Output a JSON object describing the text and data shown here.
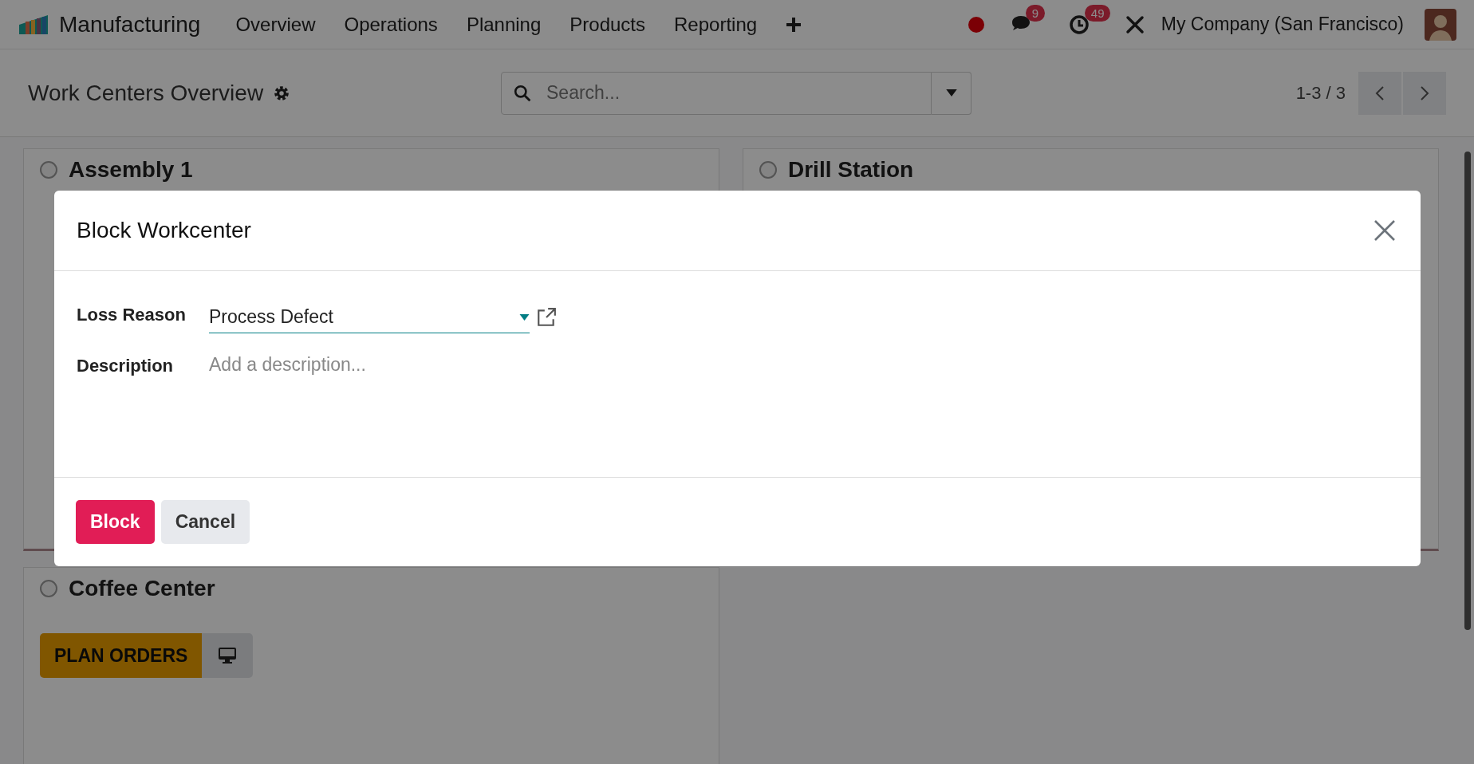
{
  "navbar": {
    "app_name": "Manufacturing",
    "menu": [
      "Overview",
      "Operations",
      "Planning",
      "Products",
      "Reporting"
    ],
    "messages_count": "9",
    "activities_count": "49",
    "company": "My Company (San Francisco)"
  },
  "control_panel": {
    "title": "Work Centers Overview",
    "search": {
      "placeholder": "Search..."
    },
    "pager": "1-3 / 3"
  },
  "work_centers": [
    {
      "name": "Assembly 1"
    },
    {
      "name": "Drill Station"
    },
    {
      "name": "Coffee Center",
      "plan_button": "PLAN ORDERS"
    }
  ],
  "dialog": {
    "title": "Block Workcenter",
    "fields": [
      {
        "label": "Loss Reason",
        "kind": "many2one",
        "value": "Process Defect"
      },
      {
        "label": "Description",
        "kind": "text",
        "placeholder": "Add a description..."
      }
    ],
    "buttons": [
      {
        "label": "Block",
        "kind": "primary"
      },
      {
        "label": "Cancel",
        "kind": "secondary"
      }
    ]
  }
}
